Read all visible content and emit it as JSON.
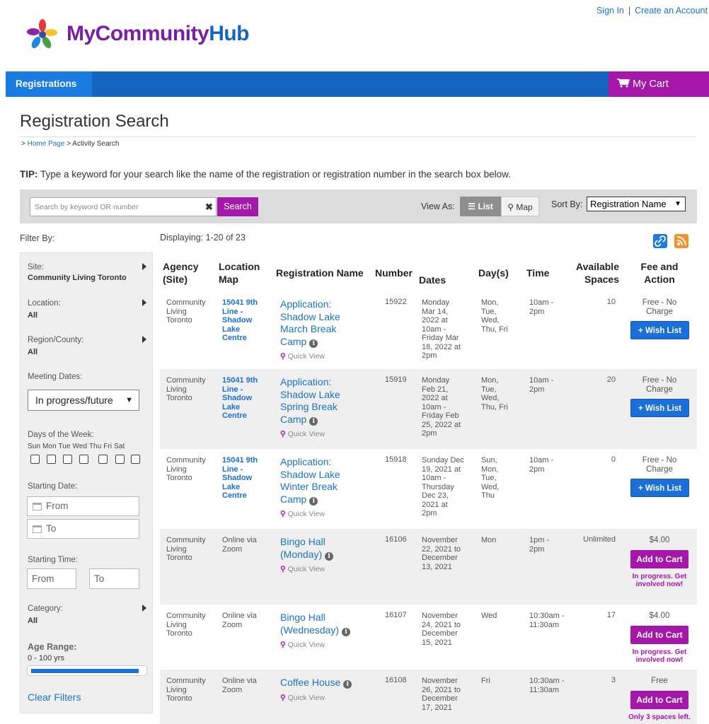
{
  "header": {
    "brand_first": "MyCommunity",
    "brand_second": "Hub",
    "sign_in": "Sign In",
    "separator": "|",
    "create_account": "Create an Account"
  },
  "nav": {
    "registrations": "Registrations",
    "cart": "My Cart"
  },
  "page": {
    "title": "Registration Search",
    "breadcrumb_prefix": "> ",
    "breadcrumb_home": "Home Page",
    "breadcrumb_current": " > Activity Search",
    "tip_label": "TIP:",
    "tip_text": " Type a keyword for your search like the name of the registration or registration number in the search box below."
  },
  "search": {
    "placeholder": "Search by keyword OR number",
    "clear": "✖",
    "button": "Search",
    "view_as": "View As:",
    "view_list": "List",
    "view_map": "Map",
    "sort_by": "Sort By:",
    "sort_value": "Registration Name"
  },
  "filters": {
    "heading": "Filter By:",
    "site_label": "Site:",
    "site_value": "Community Living Toronto",
    "location_label": "Location:",
    "location_value": "All",
    "region_label": "Region/County:",
    "region_value": "All",
    "meeting_label": "Meeting Dates:",
    "meeting_value": "In progress/future",
    "days_label": "Days of the Week:",
    "days": "Sun Mon Tue Wed Thu Fri  Sat",
    "starting_date_label": "Starting Date:",
    "from_date": "From",
    "to_date": "To",
    "starting_time_label": "Starting Time:",
    "from_time": "From",
    "to_time": "To",
    "category_label": "Category:",
    "category_value": "All",
    "age_label": "Age Range:",
    "age_value": "0 - 100 yrs",
    "age_fill": 1.0,
    "clear": "Clear Filters"
  },
  "results": {
    "displaying": "Displaying: 1-20 of 23",
    "headers": {
      "agency_1": "Agency",
      "agency_2": "(Site)",
      "location_1": "Location",
      "location_2": "Map",
      "name": "Registration Name",
      "number": "Number",
      "dates": "Dates",
      "days": "Day(s)",
      "time": "Time",
      "spaces_1": "Available",
      "spaces_2": "Spaces",
      "fee_1": "Fee and",
      "fee_2": "Action"
    },
    "quick_view": "Quick View",
    "rows": [
      {
        "agency": [
          "Community",
          "Living",
          "Toronto"
        ],
        "location": [
          "15041 9th",
          "Line -",
          "Shadow",
          "Lake",
          "Centre"
        ],
        "name": [
          "Application:",
          "Shadow Lake",
          "March Break",
          "Camp"
        ],
        "number": "15922",
        "dates": [
          "Monday",
          "Mar 14,",
          "2022 at",
          "10am -",
          "Friday Mar",
          "18, 2022 at",
          "2pm"
        ],
        "days": [
          "Mon,",
          "Tue,",
          "Wed,",
          "Thu, Fri"
        ],
        "time": [
          "10am -",
          "2pm"
        ],
        "spaces": "10",
        "fee": [
          "Free - No",
          "Charge"
        ],
        "action": "+ Wish List",
        "note": []
      },
      {
        "agency": [
          "Community",
          "Living",
          "Toronto"
        ],
        "location": [
          "15041 9th",
          "Line -",
          "Shadow",
          "Lake",
          "Centre"
        ],
        "name": [
          "Application:",
          "Shadow Lake",
          "Spring Break",
          "Camp"
        ],
        "number": "15919",
        "dates": [
          "Monday",
          "Feb 21,",
          "2022 at",
          "10am -",
          "Friday Feb",
          "25, 2022 at",
          "2pm"
        ],
        "days": [
          "Mon,",
          "Tue,",
          "Wed,",
          "Thu, Fri"
        ],
        "time": [
          "10am -",
          "2pm"
        ],
        "spaces": "20",
        "fee": [
          "Free - No",
          "Charge"
        ],
        "action": "+ Wish List",
        "note": []
      },
      {
        "agency": [
          "Community",
          "Living",
          "Toronto"
        ],
        "location": [
          "15041 9th",
          "Line -",
          "Shadow",
          "Lake",
          "Centre"
        ],
        "name": [
          "Application:",
          "Shadow Lake",
          "Winter Break",
          "Camp"
        ],
        "number": "15918",
        "dates": [
          "Sunday Dec",
          "19, 2021 at",
          "10am -",
          "Thursday",
          "Dec 23,",
          "2021 at",
          "2pm"
        ],
        "days": [
          "Sun,",
          "Mon,",
          "Tue,",
          "Wed,",
          "Thu"
        ],
        "time": [
          "10am -",
          "2pm"
        ],
        "spaces": "0",
        "fee": [
          "Free - No",
          "Charge"
        ],
        "action": "+ Wish List",
        "note": []
      },
      {
        "agency": [
          "Community",
          "Living",
          "Toronto"
        ],
        "location_plain": [
          "Online via",
          "Zoom"
        ],
        "name": [
          "Bingo Hall",
          "(Monday)"
        ],
        "number": "16106",
        "dates": [
          "November",
          "22, 2021 to",
          "December",
          "13, 2021"
        ],
        "days": [
          "Mon"
        ],
        "time": [
          "1pm -",
          "2pm"
        ],
        "spaces": "Unlimited",
        "fee": [
          "$4.00"
        ],
        "action": "Add to Cart",
        "note": [
          "In progress. Get",
          "involved now!"
        ]
      },
      {
        "agency": [
          "Community",
          "Living",
          "Toronto"
        ],
        "location_plain": [
          "Online via",
          "Zoom"
        ],
        "name": [
          "Bingo Hall",
          "(Wednesday)"
        ],
        "number": "16107",
        "dates": [
          "November",
          "24, 2021 to",
          "December",
          "15, 2021"
        ],
        "days": [
          "Wed"
        ],
        "time": [
          "10:30am -",
          "11:30am"
        ],
        "spaces": "17",
        "fee": [
          "$4.00"
        ],
        "action": "Add to Cart",
        "note": [
          "In progress. Get",
          "involved now!"
        ]
      },
      {
        "agency": [
          "Community",
          "Living",
          "Toronto"
        ],
        "location_plain": [
          "Online via",
          "Zoom"
        ],
        "name": [
          "Coffee House"
        ],
        "number": "16108",
        "dates": [
          "November",
          "26, 2021 to",
          "December",
          "17, 2021"
        ],
        "days": [
          "Fri"
        ],
        "time": [
          "10:30am -",
          "11:30am"
        ],
        "spaces": "3",
        "fee": [
          "Free"
        ],
        "action": "Add to Cart",
        "note": [
          "Only 3 spaces left."
        ]
      }
    ]
  }
}
